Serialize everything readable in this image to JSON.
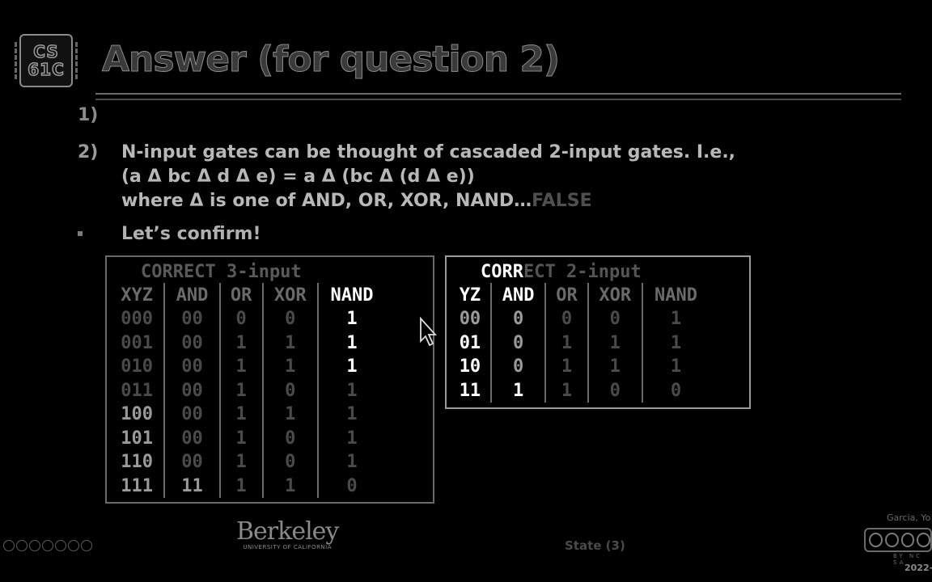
{
  "logo": {
    "line1": "CS",
    "line2": "61C"
  },
  "title": "Answer (for question 2)",
  "items": [
    {
      "num": "1)"
    },
    {
      "num": "2)",
      "line1": "N-input gates can be thought of cascaded 2-input gates. I.e.,",
      "line2": "(a Δ bc Δ d Δ e) = a Δ (bc Δ (d Δ e))",
      "line3": "where Δ is one of AND, OR, XOR, NAND…",
      "false": "FALSE"
    }
  ],
  "bullet": "Let’s confirm!",
  "table3": {
    "caption_a": "CORRECT 3-input",
    "headers": [
      "XYZ",
      "AND",
      "OR",
      "XOR",
      "NAND"
    ],
    "rows": [
      [
        "000",
        "00",
        "0",
        "0",
        "1"
      ],
      [
        "001",
        "00",
        "1",
        "1",
        "1"
      ],
      [
        "010",
        "00",
        "1",
        "1",
        "1"
      ],
      [
        "011",
        "00",
        "1",
        "0",
        "1"
      ],
      [
        "100",
        "00",
        "1",
        "1",
        "1"
      ],
      [
        "101",
        "00",
        "1",
        "0",
        "1"
      ],
      [
        "110",
        "00",
        "1",
        "0",
        "1"
      ],
      [
        "111",
        "11",
        "1",
        "1",
        "0"
      ]
    ]
  },
  "table2": {
    "caption_a": "CORR",
    "caption_b": "ECT 2-input",
    "headers": [
      "YZ",
      "AND",
      "OR",
      "XOR",
      "NAND"
    ],
    "rows": [
      [
        "00",
        "0",
        "0",
        "0",
        "1"
      ],
      [
        "01",
        "0",
        "1",
        "1",
        "1"
      ],
      [
        "10",
        "0",
        "1",
        "1",
        "1"
      ],
      [
        "11",
        "1",
        "1",
        "0",
        "0"
      ]
    ]
  },
  "footer": {
    "berkeley": "Berkeley",
    "berkeley_sub": "UNIVERSITY OF CALIFORNIA",
    "slide": "State (3)",
    "author": "Garcia, Yo",
    "license": "BY NC SA",
    "date": "2022-"
  },
  "icons": [
    "chip-logo-icon",
    "mouse-cursor-icon",
    "creative-commons-icon",
    "presentation-nav-icons"
  ]
}
